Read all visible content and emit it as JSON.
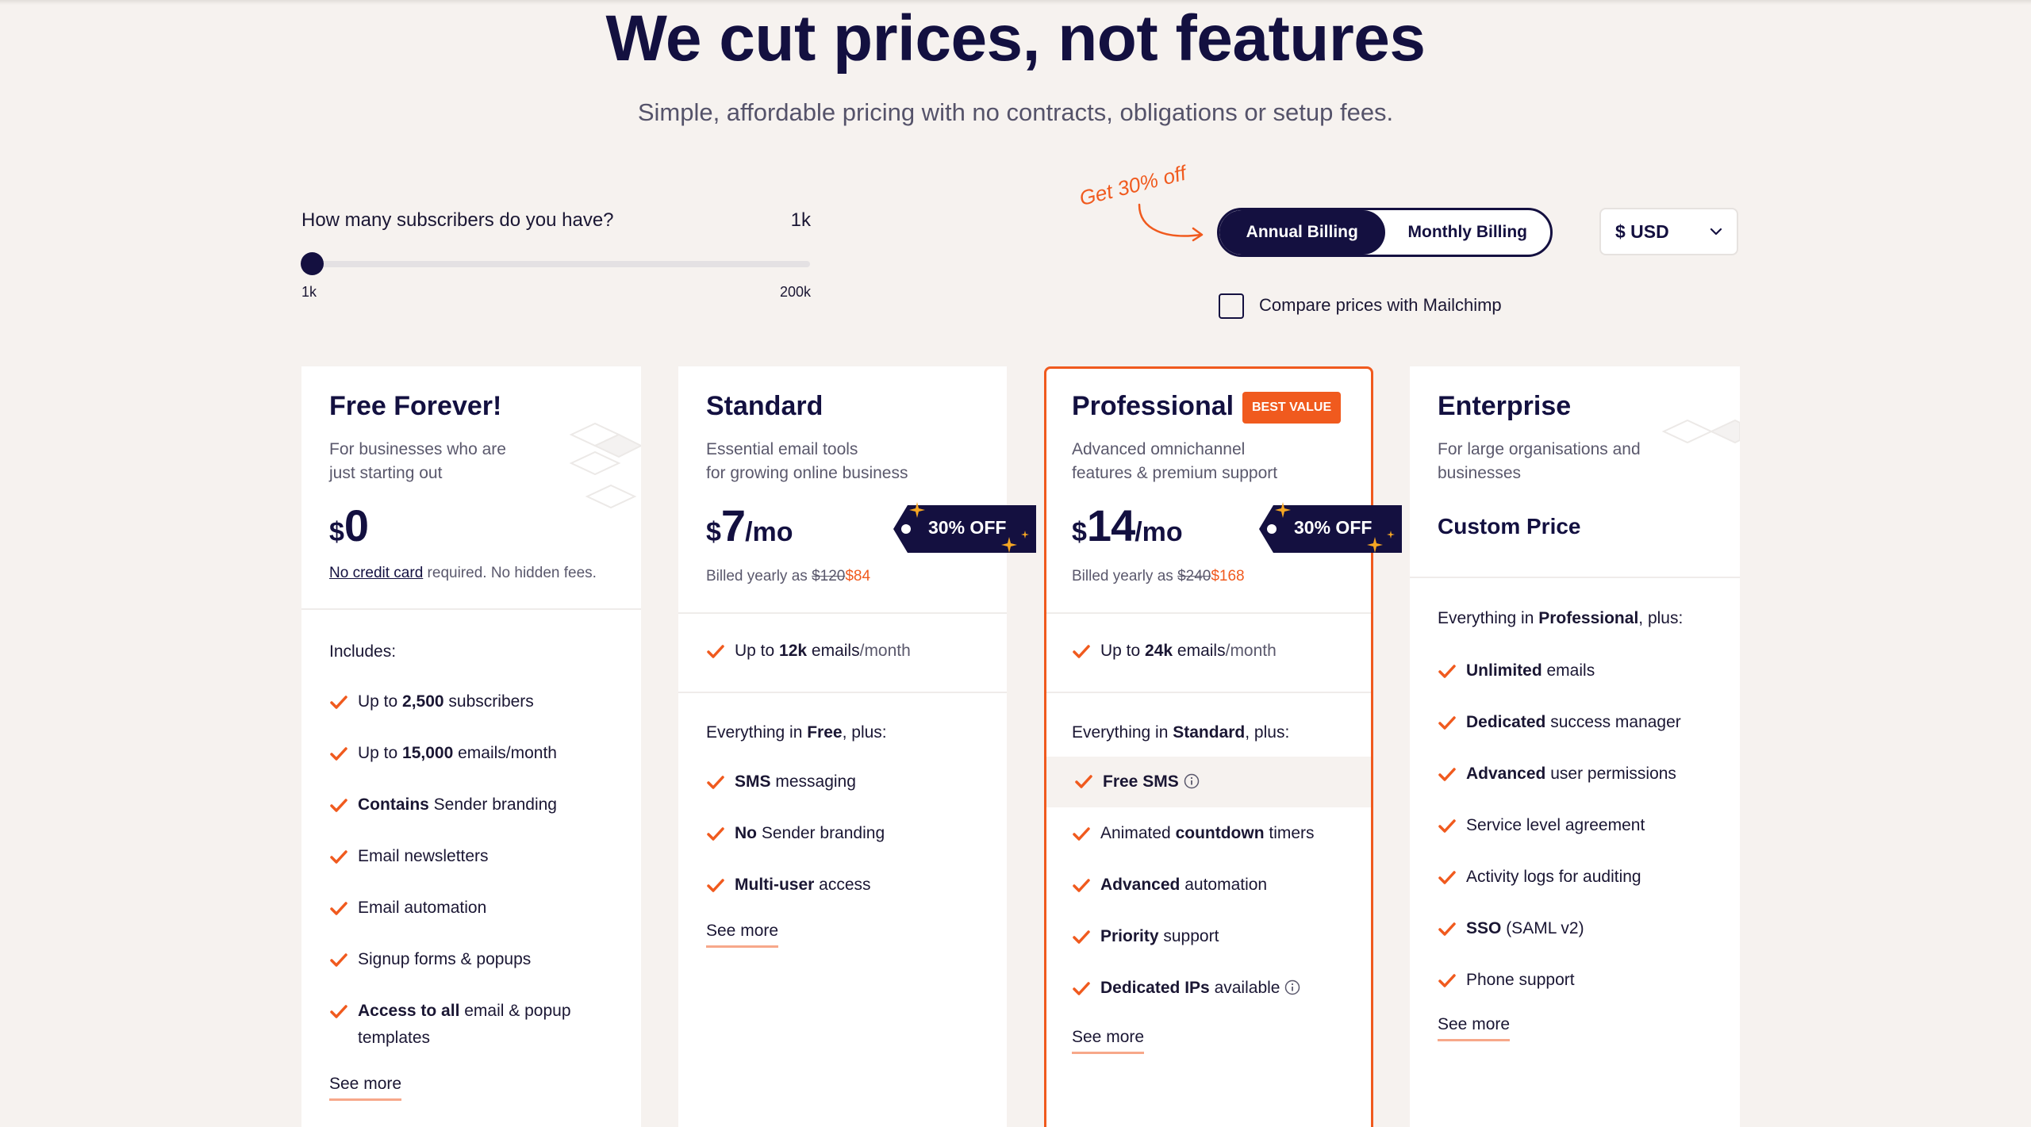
{
  "header": {
    "title": "We cut prices, not features",
    "subtitle": "Simple, affordable pricing with no contracts, obligations or setup fees."
  },
  "slider": {
    "question": "How many subscribers do you have?",
    "value": "1k",
    "min_label": "1k",
    "max_label": "200k",
    "level": 0
  },
  "billing": {
    "discount_note": "Get 30% off",
    "annual_label": "Annual Billing",
    "monthly_label": "Monthly Billing",
    "selected": "Annual Billing",
    "currency": "$ USD",
    "compare_label": "Compare prices with Mailchimp",
    "compare_checked": false
  },
  "colors": {
    "accent": "#f05a1e",
    "navy": "#141040",
    "background": "#f6f2ef"
  },
  "plans": {
    "free": {
      "title": "Free Forever!",
      "desc1": "For businesses who are",
      "desc2": "just starting out",
      "currency": "$",
      "price": "0",
      "nocc_link": "No credit card",
      "nocc_rest": " required. No hidden fees.",
      "includes": "Includes:",
      "features": [
        {
          "pre": "Up to ",
          "bold": "2,500",
          "post": " subscribers"
        },
        {
          "pre": "Up to ",
          "bold": "15,000",
          "post": " emails/month"
        },
        {
          "pre": "",
          "bold": "Contains",
          "post": " Sender branding"
        },
        {
          "pre": "Email newsletters",
          "bold": "",
          "post": ""
        },
        {
          "pre": "Email automation",
          "bold": "",
          "post": ""
        },
        {
          "pre": "Signup forms & popups",
          "bold": "",
          "post": ""
        },
        {
          "pre": "",
          "bold": "Access to all",
          "post": " email & popup templates"
        }
      ],
      "see_more": "See more"
    },
    "standard": {
      "title": "Standard",
      "desc1": "Essential email tools",
      "desc2": "for growing online business",
      "currency": "$",
      "price": "7",
      "per": "/mo",
      "tag": "30% OFF",
      "billed_pre": "Billed yearly as ",
      "billed_old": "$120",
      "billed_new": "$84",
      "quota_pre": "Up to ",
      "quota_bold": "12k",
      "quota_mid": " emails",
      "quota_post": "/month",
      "section_pre": "Everything in ",
      "section_bold": "Free",
      "section_post": ", plus:",
      "features": [
        {
          "pre": "",
          "bold": "SMS",
          "post": " messaging"
        },
        {
          "pre": "",
          "bold": "No",
          "post": " Sender branding"
        },
        {
          "pre": "",
          "bold": "Multi-user",
          "post": " access"
        }
      ],
      "see_more": "See more"
    },
    "professional": {
      "title": "Professional",
      "badge": "BEST VALUE",
      "desc1": "Advanced omnichannel",
      "desc2": "features & premium support",
      "currency": "$",
      "price": "14",
      "per": "/mo",
      "tag": "30% OFF",
      "billed_pre": "Billed yearly as ",
      "billed_old": "$240",
      "billed_new": "$168",
      "quota_pre": "Up to ",
      "quota_bold": "24k",
      "quota_mid": " emails",
      "quota_post": "/month",
      "section_pre": "Everything in ",
      "section_bold": "Standard",
      "section_post": ", plus:",
      "features": [
        {
          "pre": "",
          "bold": "Free SMS",
          "post": ""
        },
        {
          "pre": "Animated ",
          "bold": "countdown",
          "post": " timers"
        },
        {
          "pre": "",
          "bold": "Advanced",
          "post": " automation"
        },
        {
          "pre": "",
          "bold": "Priority",
          "post": " support"
        },
        {
          "pre": "",
          "bold": "Dedicated IPs",
          "post": " available"
        }
      ],
      "see_more": "See more"
    },
    "enterprise": {
      "title": "Enterprise",
      "desc1": "For large organisations and",
      "desc2": "businesses",
      "price_label": "Custom Price",
      "section_pre": "Everything in ",
      "section_bold": "Professional",
      "section_post": ", plus:",
      "features": [
        {
          "pre": "",
          "bold": "Unlimited",
          "post": " emails"
        },
        {
          "pre": "",
          "bold": "Dedicated",
          "post": " success manager"
        },
        {
          "pre": "",
          "bold": "Advanced",
          "post": " user permissions"
        },
        {
          "pre": "Service level agreement",
          "bold": "",
          "post": ""
        },
        {
          "pre": "Activity logs for auditing",
          "bold": "",
          "post": ""
        },
        {
          "pre": "",
          "bold": "SSO",
          "post": " (SAML v2)"
        },
        {
          "pre": "Phone support",
          "bold": "",
          "post": ""
        }
      ],
      "see_more": "See more"
    }
  }
}
